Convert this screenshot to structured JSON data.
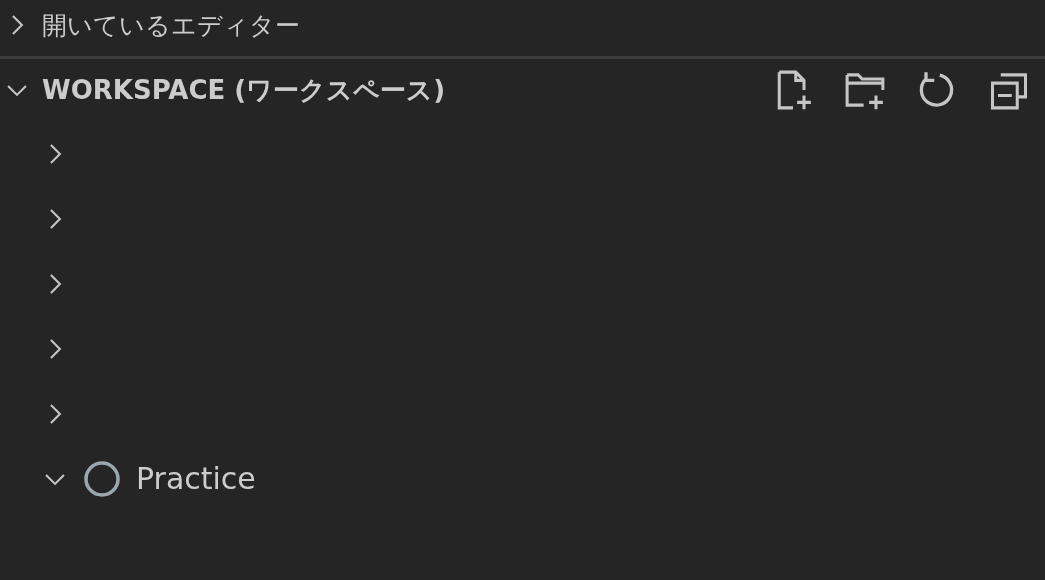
{
  "sections": [
    {
      "kind": "editors",
      "title": "開いているエディター",
      "expanded": false
    },
    {
      "kind": "workspace",
      "title": "WORKSPACE (ワークスペース)",
      "expanded": true,
      "items": [
        {
          "expanded": false,
          "has_icon": false
        },
        {
          "expanded": false,
          "has_icon": false
        },
        {
          "expanded": false,
          "has_icon": false
        },
        {
          "expanded": false,
          "has_icon": false
        },
        {
          "expanded": false,
          "has_icon": false
        },
        {
          "label": "Practice",
          "expanded": true,
          "has_icon": true
        }
      ]
    }
  ]
}
